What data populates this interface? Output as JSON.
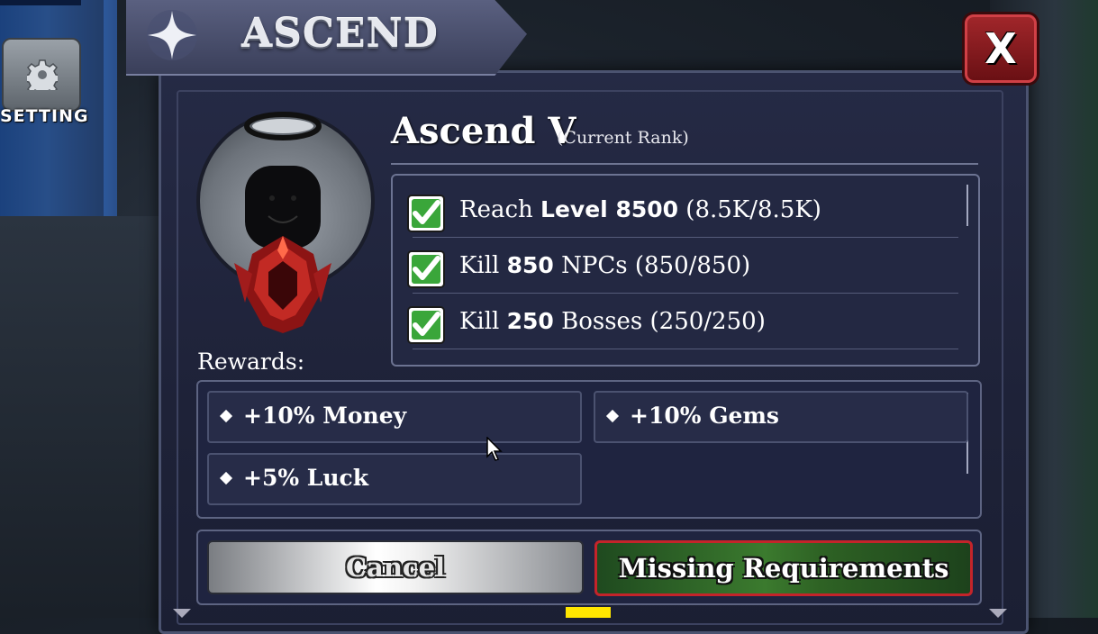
{
  "hud": {
    "setting_label": "SETTING"
  },
  "dialog": {
    "title": "ASCEND",
    "close_label": "X",
    "rank_name": "Ascend V",
    "rank_status": "(Current Rank)",
    "requirements": [
      {
        "prefix": "Reach ",
        "bold": "Level 8500",
        "suffix": " (8.5K/8.5K)",
        "met": true
      },
      {
        "prefix": "Kill ",
        "bold": "850",
        "suffix": " NPCs (850/850)",
        "met": true
      },
      {
        "prefix": "Kill ",
        "bold": "250",
        "suffix": " Bosses (250/250)",
        "met": true
      }
    ],
    "rewards_label": "Rewards:",
    "rewards": [
      {
        "label": "+10% Money"
      },
      {
        "label": "+10% Gems"
      },
      {
        "label": "+5% Luck"
      }
    ],
    "cancel_label": "Cancel",
    "confirm_label": "Missing Requirements"
  },
  "colors": {
    "panel": "#232842",
    "check_green": "#3aa63a",
    "close_red": "#a0262a",
    "confirm_border": "#c4242a"
  }
}
